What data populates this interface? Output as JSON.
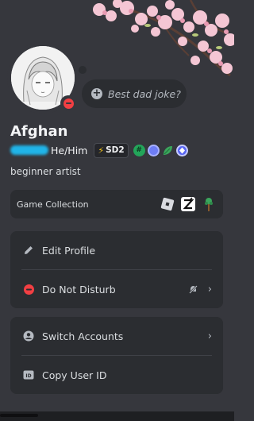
{
  "profile": {
    "display_name": "Afghan",
    "pronouns": "He/Him",
    "status_placeholder": "Best dad joke?",
    "bio": "beginner artist",
    "server_tag": "SD2",
    "status": "do-not-disturb"
  },
  "badges": [
    {
      "name": "hashtag-badge-icon",
      "color": "#23a55a"
    },
    {
      "name": "hypesquad-badge-icon",
      "color": "#6e7df5"
    },
    {
      "name": "leaf-badge-icon",
      "color": "#3ba55c"
    },
    {
      "name": "nitro-badge-icon",
      "color": "#5865f2"
    }
  ],
  "game_collection": {
    "label": "Game Collection",
    "games": [
      "roblox-icon",
      "zenless-zone-zero-icon",
      "terraria-tree-icon"
    ]
  },
  "menu_group_1": [
    {
      "label": "Edit Profile",
      "icon": "pencil-icon"
    },
    {
      "label": "Do Not Disturb",
      "icon": "dnd-status-icon",
      "extra_icon": "notifications-off-icon",
      "chevron": "›"
    }
  ],
  "menu_group_2": [
    {
      "label": "Switch Accounts",
      "icon": "user-circle-icon",
      "chevron": "›"
    },
    {
      "label": "Copy User ID",
      "icon": "id-card-icon"
    }
  ],
  "colors": {
    "background": "#36373d",
    "card": "#2b2d31",
    "dnd_red": "#f23f43",
    "username_highlight": "#20b4e8"
  }
}
